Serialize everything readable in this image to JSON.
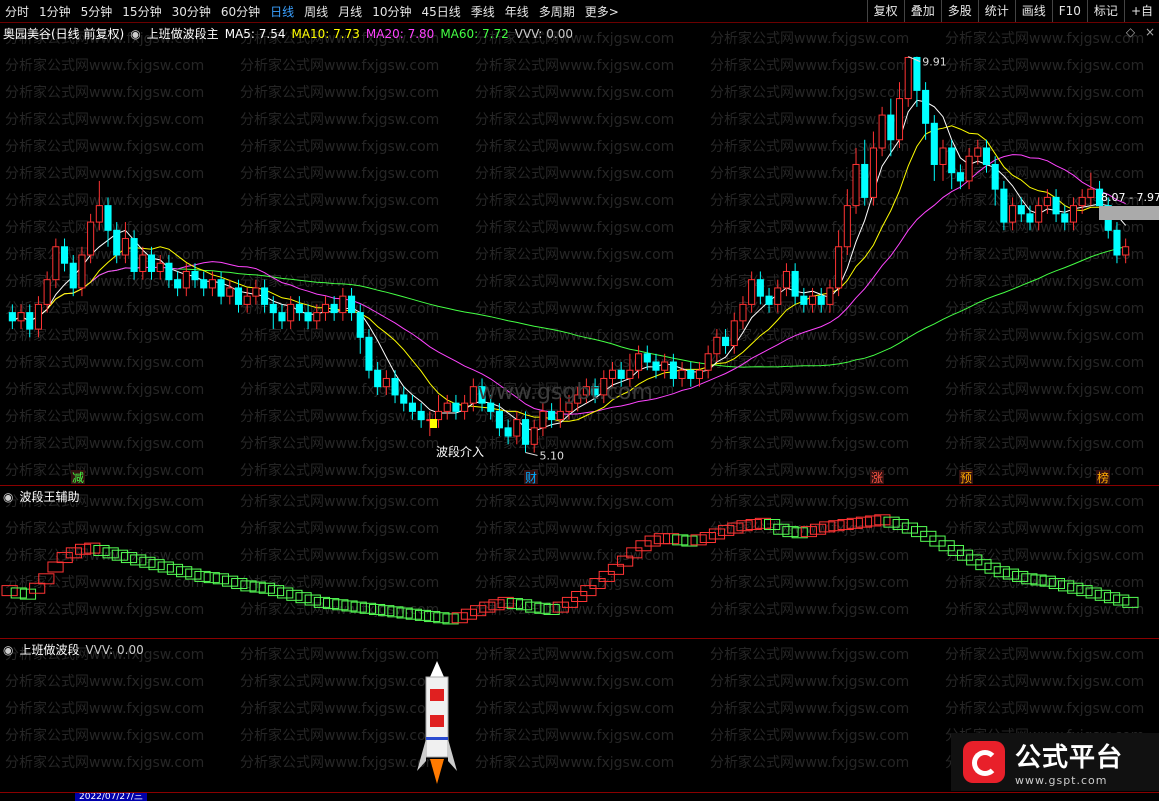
{
  "toolbar": {
    "periods": [
      "分时",
      "1分钟",
      "5分钟",
      "15分钟",
      "30分钟",
      "60分钟",
      "日线",
      "周线",
      "月线",
      "10分钟",
      "45日线",
      "季线",
      "年线",
      "多周期",
      "更多>"
    ],
    "active": "日线",
    "right_buttons": [
      "复权",
      "叠加",
      "多股",
      "统计",
      "画线",
      "F10",
      "标记",
      "+自"
    ]
  },
  "main_panel": {
    "stock_name": "奥园美谷(日线 前复权)",
    "indicator_name": "上班做波段主",
    "ma5": "MA5: 7.54",
    "ma10": "MA10: 7.73",
    "ma20": "MA20: 7.80",
    "ma60": "MA60: 7.72",
    "vvv": "VVV: 0.00",
    "high_label": "9.91",
    "low_label": "5.10",
    "crosshair_label": "8.07 - 7.97",
    "entry_label": "波段介入",
    "markers": [
      "减",
      "财",
      "涨",
      "预",
      "榜"
    ],
    "icons": [
      "diamond-icon",
      "close-icon"
    ],
    "colors": {
      "ma5": "#ffffff",
      "ma10": "#ffff00",
      "ma20": "#ff44ff",
      "ma60": "#44ff44",
      "up": "#ff3333",
      "down": "#00ffff"
    }
  },
  "sub_panel1": {
    "title": "波段王辅助"
  },
  "sub_panel2": {
    "title": "上班做波段",
    "vvv": "VVV: 0.00"
  },
  "watermark": {
    "text": "分析家公式网www.fxjgsw.com",
    "center": "www.gsgbt.com"
  },
  "bottom": {
    "date": "2022/07/27/三"
  },
  "logo": {
    "title": "公式平台",
    "url": "www.gspt.com"
  },
  "chart_data": {
    "type": "candlestick",
    "title": "奥园美谷(日线 前复权)",
    "high_annotation": 9.91,
    "low_annotation": 5.1,
    "series": [
      {
        "name": "MA5",
        "value": 7.54
      },
      {
        "name": "MA10",
        "value": 7.73
      },
      {
        "name": "MA20",
        "value": 7.8
      },
      {
        "name": "MA60",
        "value": 7.72
      }
    ],
    "candles": [
      [
        6.8,
        6.7,
        6.9,
        6.6
      ],
      [
        6.7,
        6.8,
        6.9,
        6.6
      ],
      [
        6.8,
        6.6,
        6.9,
        6.5
      ],
      [
        6.6,
        6.9,
        7.0,
        6.5
      ],
      [
        6.9,
        7.2,
        7.3,
        6.8
      ],
      [
        7.2,
        7.6,
        7.7,
        7.1
      ],
      [
        7.6,
        7.4,
        7.7,
        7.3
      ],
      [
        7.4,
        7.1,
        7.5,
        7.0
      ],
      [
        7.1,
        7.5,
        7.6,
        7.0
      ],
      [
        7.5,
        7.9,
        8.0,
        7.4
      ],
      [
        7.9,
        8.1,
        8.4,
        7.8
      ],
      [
        8.1,
        7.8,
        8.2,
        7.6
      ],
      [
        7.8,
        7.5,
        7.9,
        7.4
      ],
      [
        7.5,
        7.7,
        7.9,
        7.4
      ],
      [
        7.7,
        7.3,
        7.8,
        7.2
      ],
      [
        7.3,
        7.5,
        7.6,
        7.2
      ],
      [
        7.5,
        7.3,
        7.6,
        7.2
      ],
      [
        7.3,
        7.4,
        7.5,
        7.2
      ],
      [
        7.4,
        7.2,
        7.5,
        7.1
      ],
      [
        7.2,
        7.1,
        7.3,
        7.0
      ],
      [
        7.1,
        7.3,
        7.4,
        7.0
      ],
      [
        7.3,
        7.2,
        7.4,
        7.1
      ],
      [
        7.2,
        7.1,
        7.3,
        7.0
      ],
      [
        7.1,
        7.2,
        7.3,
        7.0
      ],
      [
        7.2,
        7.0,
        7.3,
        6.9
      ],
      [
        7.0,
        7.1,
        7.2,
        6.9
      ],
      [
        7.1,
        6.9,
        7.2,
        6.8
      ],
      [
        6.9,
        7.0,
        7.1,
        6.8
      ],
      [
        7.0,
        7.1,
        7.2,
        6.9
      ],
      [
        7.1,
        6.9,
        7.2,
        6.8
      ],
      [
        6.9,
        6.8,
        7.0,
        6.6
      ],
      [
        6.8,
        6.7,
        6.9,
        6.6
      ],
      [
        6.7,
        6.9,
        7.0,
        6.6
      ],
      [
        6.9,
        6.8,
        7.0,
        6.7
      ],
      [
        6.8,
        6.7,
        6.9,
        6.6
      ],
      [
        6.7,
        6.8,
        6.9,
        6.6
      ],
      [
        6.8,
        6.9,
        7.0,
        6.7
      ],
      [
        6.9,
        6.8,
        7.0,
        6.7
      ],
      [
        6.8,
        7.0,
        7.1,
        6.7
      ],
      [
        7.0,
        6.8,
        7.1,
        6.7
      ],
      [
        6.8,
        6.5,
        6.9,
        6.3
      ],
      [
        6.5,
        6.1,
        6.6,
        6.0
      ],
      [
        6.1,
        5.9,
        6.2,
        5.8
      ],
      [
        5.9,
        6.0,
        6.1,
        5.8
      ],
      [
        6.0,
        5.8,
        6.1,
        5.7
      ],
      [
        5.8,
        5.7,
        5.9,
        5.6
      ],
      [
        5.7,
        5.6,
        5.8,
        5.5
      ],
      [
        5.6,
        5.5,
        5.7,
        5.4
      ],
      [
        5.5,
        5.5,
        5.6,
        5.3
      ],
      [
        5.5,
        5.6,
        5.8,
        5.4
      ],
      [
        5.6,
        5.7,
        5.8,
        5.5
      ],
      [
        5.7,
        5.6,
        5.8,
        5.5
      ],
      [
        5.6,
        5.7,
        5.8,
        5.5
      ],
      [
        5.7,
        5.9,
        6.0,
        5.6
      ],
      [
        5.9,
        5.7,
        6.0,
        5.6
      ],
      [
        5.7,
        5.6,
        5.8,
        5.5
      ],
      [
        5.6,
        5.4,
        5.7,
        5.3
      ],
      [
        5.4,
        5.3,
        5.5,
        5.2
      ],
      [
        5.3,
        5.5,
        5.6,
        5.2
      ],
      [
        5.5,
        5.2,
        5.6,
        5.1
      ],
      [
        5.2,
        5.4,
        5.5,
        5.1
      ],
      [
        5.4,
        5.6,
        5.7,
        5.3
      ],
      [
        5.6,
        5.5,
        5.7,
        5.4
      ],
      [
        5.5,
        5.6,
        5.8,
        5.4
      ],
      [
        5.6,
        5.7,
        5.8,
        5.5
      ],
      [
        5.7,
        5.8,
        5.9,
        5.6
      ],
      [
        5.8,
        5.9,
        6.0,
        5.7
      ],
      [
        5.9,
        5.8,
        6.0,
        5.7
      ],
      [
        5.8,
        6.0,
        6.1,
        5.7
      ],
      [
        6.0,
        6.1,
        6.2,
        5.9
      ],
      [
        6.1,
        6.0,
        6.2,
        5.9
      ],
      [
        6.0,
        6.1,
        6.3,
        5.9
      ],
      [
        6.1,
        6.3,
        6.4,
        6.0
      ],
      [
        6.3,
        6.2,
        6.4,
        6.1
      ],
      [
        6.2,
        6.1,
        6.3,
        6.0
      ],
      [
        6.1,
        6.2,
        6.3,
        6.0
      ],
      [
        6.2,
        6.0,
        6.3,
        5.9
      ],
      [
        6.0,
        6.1,
        6.2,
        5.9
      ],
      [
        6.1,
        6.0,
        6.2,
        5.9
      ],
      [
        6.0,
        6.1,
        6.2,
        5.9
      ],
      [
        6.1,
        6.3,
        6.4,
        6.0
      ],
      [
        6.3,
        6.5,
        6.6,
        6.2
      ],
      [
        6.5,
        6.4,
        6.6,
        6.3
      ],
      [
        6.4,
        6.7,
        6.8,
        6.3
      ],
      [
        6.7,
        6.9,
        7.0,
        6.6
      ],
      [
        6.9,
        7.2,
        7.3,
        6.8
      ],
      [
        7.2,
        7.0,
        7.3,
        6.9
      ],
      [
        7.0,
        6.9,
        7.1,
        6.8
      ],
      [
        6.9,
        7.1,
        7.2,
        6.8
      ],
      [
        7.1,
        7.3,
        7.4,
        7.0
      ],
      [
        7.3,
        7.0,
        7.4,
        6.9
      ],
      [
        7.0,
        6.9,
        7.1,
        6.8
      ],
      [
        6.9,
        7.0,
        7.1,
        6.8
      ],
      [
        7.0,
        6.9,
        7.1,
        6.8
      ],
      [
        6.9,
        7.1,
        7.2,
        6.8
      ],
      [
        7.1,
        7.6,
        7.8,
        7.0
      ],
      [
        7.6,
        8.1,
        8.3,
        7.5
      ],
      [
        8.1,
        8.6,
        8.8,
        8.0
      ],
      [
        8.6,
        8.2,
        8.9,
        8.1
      ],
      [
        8.2,
        8.8,
        9.0,
        8.1
      ],
      [
        8.8,
        9.2,
        9.3,
        8.7
      ],
      [
        9.2,
        8.9,
        9.4,
        8.7
      ],
      [
        8.9,
        9.4,
        9.6,
        8.8
      ],
      [
        9.4,
        9.9,
        9.91,
        9.3
      ],
      [
        9.9,
        9.5,
        9.91,
        9.3
      ],
      [
        9.5,
        9.1,
        9.6,
        8.9
      ],
      [
        9.1,
        8.6,
        9.2,
        8.4
      ],
      [
        8.6,
        8.8,
        8.9,
        8.4
      ],
      [
        8.8,
        8.5,
        8.9,
        8.3
      ],
      [
        8.5,
        8.4,
        8.6,
        8.3
      ],
      [
        8.4,
        8.7,
        8.8,
        8.3
      ],
      [
        8.7,
        8.8,
        8.9,
        8.6
      ],
      [
        8.8,
        8.6,
        8.9,
        8.5
      ],
      [
        8.6,
        8.3,
        8.7,
        8.1
      ],
      [
        8.3,
        7.9,
        8.4,
        7.8
      ],
      [
        7.9,
        8.1,
        8.2,
        7.8
      ],
      [
        8.1,
        8.0,
        8.2,
        7.9
      ],
      [
        8.0,
        7.9,
        8.1,
        7.8
      ],
      [
        7.9,
        8.1,
        8.2,
        7.8
      ],
      [
        8.1,
        8.2,
        8.3,
        8.0
      ],
      [
        8.2,
        8.0,
        8.3,
        7.9
      ],
      [
        8.0,
        7.9,
        8.1,
        7.8
      ],
      [
        7.9,
        8.1,
        8.2,
        7.8
      ],
      [
        8.1,
        8.2,
        8.3,
        8.0
      ],
      [
        8.2,
        8.3,
        8.5,
        8.1
      ],
      [
        8.3,
        8.1,
        8.4,
        8.0
      ],
      [
        8.1,
        7.8,
        8.2,
        7.7
      ],
      [
        7.8,
        7.5,
        7.9,
        7.4
      ],
      [
        7.5,
        7.6,
        7.7,
        7.4
      ]
    ],
    "wave_indicator": [
      0.3,
      0.28,
      0.27,
      0.32,
      0.4,
      0.5,
      0.58,
      0.62,
      0.65,
      0.66,
      0.64,
      0.62,
      0.6,
      0.58,
      0.56,
      0.54,
      0.52,
      0.5,
      0.48,
      0.46,
      0.44,
      0.42,
      0.41,
      0.4,
      0.38,
      0.36,
      0.34,
      0.33,
      0.32,
      0.3,
      0.28,
      0.26,
      0.24,
      0.22,
      0.2,
      0.19,
      0.18,
      0.17,
      0.16,
      0.15,
      0.14,
      0.13,
      0.12,
      0.11,
      0.1,
      0.09,
      0.08,
      0.07,
      0.06,
      0.07,
      0.1,
      0.13,
      0.16,
      0.18,
      0.2,
      0.19,
      0.18,
      0.16,
      0.15,
      0.14,
      0.16,
      0.2,
      0.25,
      0.3,
      0.36,
      0.42,
      0.48,
      0.55,
      0.62,
      0.68,
      0.72,
      0.74,
      0.74,
      0.73,
      0.72,
      0.73,
      0.75,
      0.78,
      0.81,
      0.83,
      0.85,
      0.86,
      0.87,
      0.86,
      0.82,
      0.8,
      0.79,
      0.8,
      0.82,
      0.84,
      0.85,
      0.86,
      0.87,
      0.88,
      0.89,
      0.9,
      0.88,
      0.86,
      0.83,
      0.8,
      0.76,
      0.72,
      0.68,
      0.64,
      0.6,
      0.56,
      0.52,
      0.49,
      0.46,
      0.44,
      0.42,
      0.4,
      0.39,
      0.38,
      0.36,
      0.34,
      0.32,
      0.3,
      0.28,
      0.26,
      0.24,
      0.22,
      0.2
    ]
  }
}
